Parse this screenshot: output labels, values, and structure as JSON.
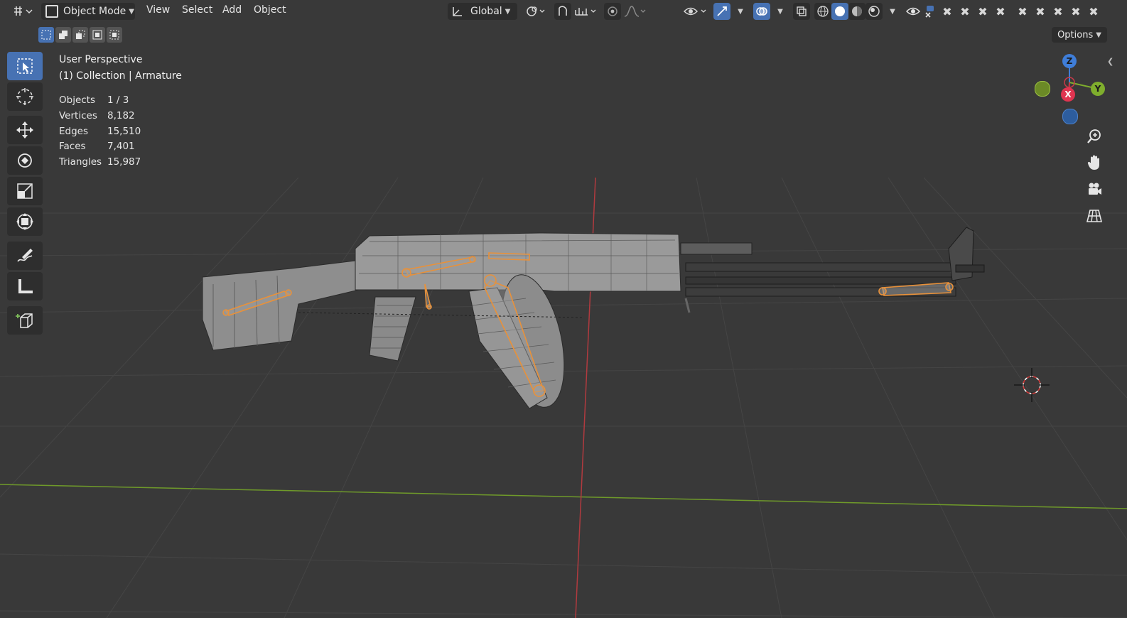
{
  "header": {
    "mode_label": "Object Mode",
    "menus": [
      "View",
      "Select",
      "Add",
      "Object"
    ],
    "transform_orientation": "Global"
  },
  "tool_settings": {
    "options_label": "Options"
  },
  "viewport": {
    "perspective_label": "User Perspective",
    "collection_label": "(1) Collection | Armature",
    "stats": [
      {
        "label": "Objects",
        "value": "1 / 3"
      },
      {
        "label": "Vertices",
        "value": "8,182"
      },
      {
        "label": "Edges",
        "value": "15,510"
      },
      {
        "label": "Faces",
        "value": "7,401"
      },
      {
        "label": "Triangles",
        "value": "15,987"
      }
    ]
  },
  "gizmo": {
    "z_label": "Z",
    "y_label": "Y",
    "x_label": "X"
  },
  "colors": {
    "accent": "#4772b3",
    "armature": "#e8913a",
    "x_axis": "#c93a49",
    "y_axis": "#7fae2d",
    "z_axis": "#3f7ed9",
    "background": "#393939"
  },
  "icons": {
    "editor_type": "editor-type-icon",
    "mode": "object-mode-icon",
    "orientation": "transform-orientation-icon",
    "pivot": "pivot-point-icon",
    "snap": "snap-magnet-icon",
    "proportional": "proportional-editing-icon",
    "visibility": "eye-icon",
    "gizmo": "gizmo-icon",
    "overlays": "overlays-icon",
    "xray": "xray-icon",
    "shading": [
      "wireframe-shading-icon",
      "solid-shading-icon",
      "material-shading-icon",
      "rendered-shading-icon"
    ]
  }
}
